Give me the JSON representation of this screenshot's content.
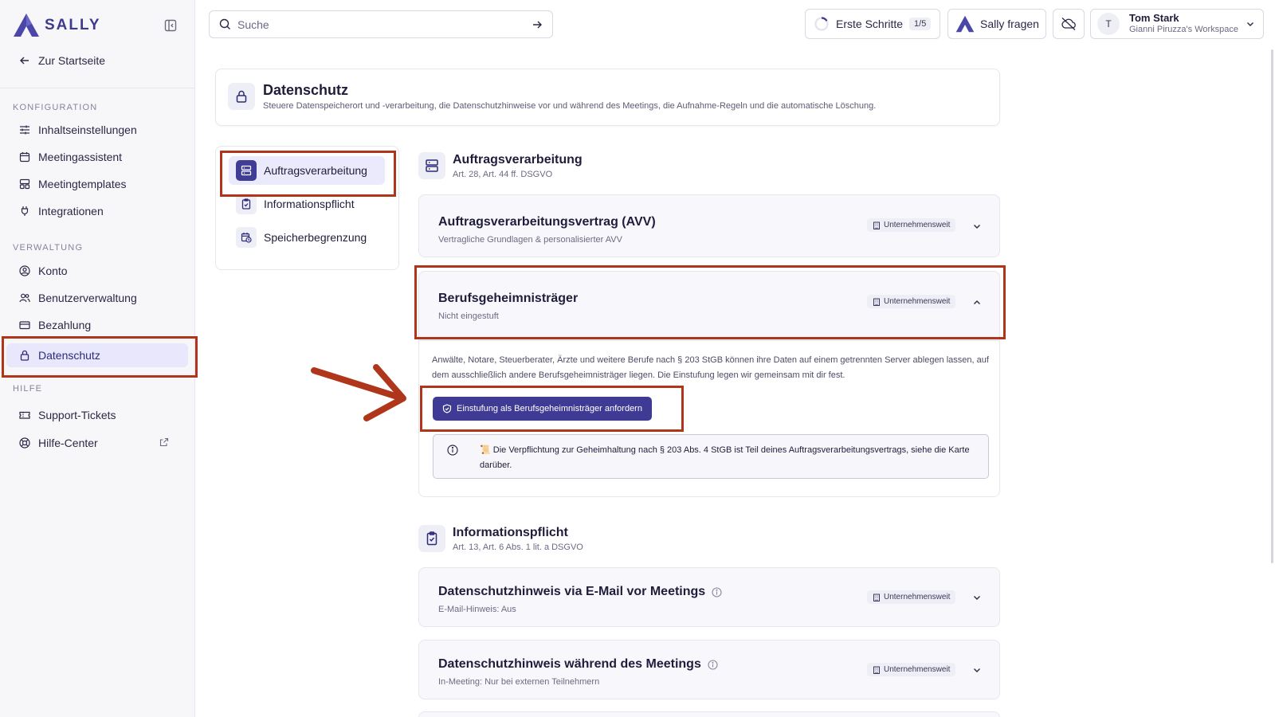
{
  "brand": {
    "name": "SALLY"
  },
  "sidebar": {
    "back_label": "Zur Startseite",
    "sections": [
      {
        "label": "KONFIGURATION",
        "items": [
          {
            "label": "Inhaltseinstellungen",
            "icon": "sliders-icon"
          },
          {
            "label": "Meetingassistent",
            "icon": "calendar-icon"
          },
          {
            "label": "Meetingtemplates",
            "icon": "template-icon"
          },
          {
            "label": "Integrationen",
            "icon": "plug-icon"
          }
        ]
      },
      {
        "label": "VERWALTUNG",
        "items": [
          {
            "label": "Konto",
            "icon": "user-circle-icon"
          },
          {
            "label": "Benutzerverwaltung",
            "icon": "users-icon"
          },
          {
            "label": "Bezahlung",
            "icon": "credit-card-icon"
          },
          {
            "label": "Datenschutz",
            "icon": "lock-icon",
            "active": true
          }
        ]
      },
      {
        "label": "HILFE",
        "items": [
          {
            "label": "Support-Tickets",
            "icon": "ticket-icon"
          },
          {
            "label": "Hilfe-Center",
            "icon": "lifebuoy-icon",
            "external": true
          }
        ]
      }
    ]
  },
  "topbar": {
    "search_placeholder": "Suche",
    "onboarding_label": "Erste Schritte",
    "onboarding_progress": "1/5",
    "ask_label": "Sally fragen",
    "user": {
      "initial": "T",
      "name": "Tom Stark",
      "workspace": "Gianni Piruzza's Workspace"
    }
  },
  "page": {
    "title": "Datenschutz",
    "description": "Steuere Datenspeicherort und -verarbeitung, die Datenschutzhinweise vor und während des Meetings, die Aufnahme-Regeln und die automatische Löschung."
  },
  "subnav": {
    "items": [
      {
        "label": "Auftragsverarbeitung",
        "active": true
      },
      {
        "label": "Informationspflicht"
      },
      {
        "label": "Speicherbegrenzung"
      }
    ]
  },
  "sections": {
    "auftrag": {
      "title": "Auftragsverarbeitung",
      "subtitle": "Art. 28, Art. 44 ff. DSGVO",
      "cards": {
        "avv": {
          "title": "Auftragsverarbeitungsvertrag (AVV)",
          "subtitle": "Vertragliche Grundlagen & personalisierter AVV",
          "badge": "Unternehmensweit"
        },
        "berufs": {
          "title": "Berufsgeheimnisträger",
          "subtitle": "Nicht eingestuft",
          "badge": "Unternehmensweit",
          "body": "Anwälte, Notare, Steuerberater, Ärzte und weitere Berufe nach § 203 StGB können ihre Daten auf einem getrennten Server ablegen lassen, auf dem ausschließlich andere Berufsgeheimnisträger liegen. Die Einstufung legen wir gemeinsam mit dir fest.",
          "cta": "Einstufung als Berufsgeheimnisträger anfordern",
          "note": "📜 Die Verpflichtung zur Geheimhaltung nach § 203 Abs. 4 StGB ist Teil deines Auftragsverarbeitungsvertrags, siehe die Karte darüber."
        }
      }
    },
    "info": {
      "title": "Informationspflicht",
      "subtitle": "Art. 13, Art. 6 Abs. 1 lit. a DSGVO",
      "cards": {
        "email": {
          "title": "Datenschutzhinweis via E-Mail vor Meetings",
          "subtitle": "E-Mail-Hinweis: Aus",
          "badge": "Unternehmensweit"
        },
        "meeting": {
          "title": "Datenschutzhinweis während des Meetings",
          "subtitle": "In-Meeting: Nur bei externen Teilnehmern",
          "badge": "Unternehmensweit"
        }
      }
    }
  },
  "colors": {
    "accent": "#3f3b94",
    "highlight": "#b0361b",
    "active_bg": "#e8e7fb"
  }
}
